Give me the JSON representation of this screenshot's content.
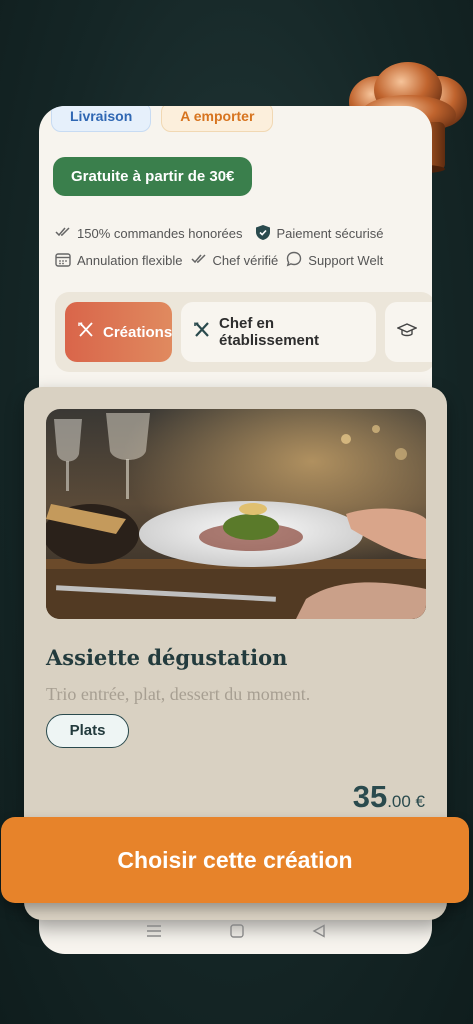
{
  "header": {
    "delivery_label": "Livraison",
    "takeaway_label": "A emporter",
    "free_delivery": "Gratuite à partir de 30€"
  },
  "features": [
    {
      "icon": "double-check-icon",
      "label": "150% commandes honorées"
    },
    {
      "icon": "shield-icon",
      "label": "Paiement sécurisé"
    },
    {
      "icon": "calendar-icon",
      "label": "Annulation flexible"
    },
    {
      "icon": "double-check-icon",
      "label": "Chef vérifié"
    },
    {
      "icon": "chat-bubble-icon",
      "label": "Support Welt"
    }
  ],
  "tabs": [
    {
      "icon": "utensils-cross-icon",
      "label": "Créations",
      "active": true
    },
    {
      "icon": "utensils-cross-icon",
      "label": "Chef en établissement",
      "active": false
    },
    {
      "icon": "graduation-cap-icon",
      "label": "",
      "active": false
    }
  ],
  "card": {
    "title": "Assiette dégustation",
    "description": "Trio entrée, plat, dessert du moment.",
    "tag": "Plats",
    "price_int": "35",
    "price_dec": ".00 €"
  },
  "cta_label": "Choisir cette création",
  "colors": {
    "accent_orange": "#e7832a",
    "active_tab": "#d9654a",
    "green_badge": "#3a7f4c",
    "dark_teal": "#233b3d"
  }
}
